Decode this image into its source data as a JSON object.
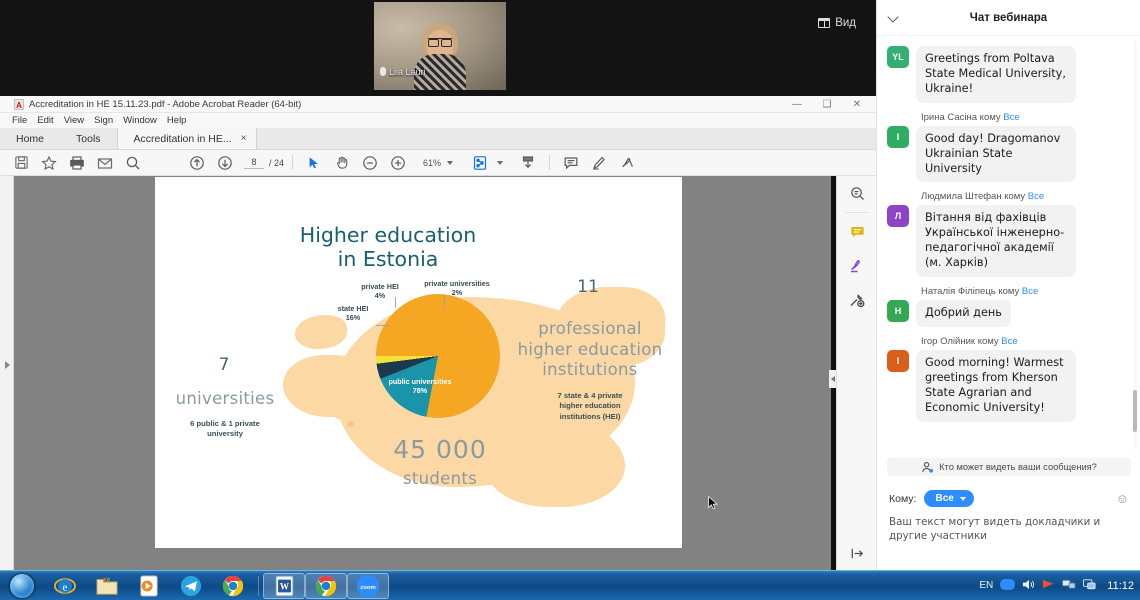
{
  "meeting": {
    "view_button_label": "Вид",
    "view_button_icon": "grid-view-icon",
    "speaker_name": "Liia Lauri"
  },
  "acrobat": {
    "window_title": "Accreditation in HE 15.11.23.pdf - Adobe Acrobat Reader (64-bit)",
    "menu": [
      "File",
      "Edit",
      "View",
      "Sign",
      "Window",
      "Help"
    ],
    "tabs": [
      {
        "label": "Home"
      },
      {
        "label": "Tools"
      },
      {
        "label": "Accreditation in HE...",
        "close": "×",
        "active": true
      }
    ],
    "window_controls": {
      "minimize": "—",
      "maximize": "❑",
      "close": "✕"
    },
    "toolbar": {
      "save_icon": "save-icon",
      "star_icon": "star-icon",
      "print_icon": "print-icon",
      "email_icon": "email-icon",
      "search_icon": "search-icon",
      "prev_page_icon": "arrow-up-circle-icon",
      "next_page_icon": "arrow-down-circle-icon",
      "current_page": "8",
      "page_total": "/ 24",
      "select_tool_icon": "cursor-arrow-icon",
      "hand_tool_icon": "hand-icon",
      "zoom_out_icon": "zoom-out-icon",
      "zoom_in_icon": "zoom-in-icon",
      "zoom_level": "61%",
      "page_fit_icon": "page-fit-icon",
      "scroll_mode_icon": "scroll-mode-icon",
      "comment_icon": "comment-icon",
      "highlight_icon": "highlight-pen-icon",
      "sign_icon": "sign-icon"
    },
    "right_tools": {
      "search_icon": "search-document-icon",
      "comment_icon": "comment-tool-icon",
      "fill_sign_icon": "fill-and-sign-icon",
      "more_tools_icon": "more-tools-icon",
      "expand_panel_icon": "expand-panel-icon",
      "collapse_arrow_icon": "collapse-left-arrow-icon"
    }
  },
  "slide": {
    "title_line1": "Higher education",
    "title_line2": "in Estonia",
    "universities_number": "7",
    "universities_word": "universities",
    "universities_note": "6 public & 1 private\nuniversity",
    "institutions_number": "11",
    "institutions_word": "professional\nhigher education\ninstitutions",
    "institutions_note": "7 state & 4 private\nhigher education\ninstitutions (HEI)",
    "students_number": "45 000",
    "students_word": "students",
    "colors": {
      "title": "#17616f",
      "map": "#fcd9a4",
      "public_universities": "#f5a623",
      "state_hei": "#1a94a8",
      "private_hei": "#1d3a4d",
      "private_universities": "#f5e33c"
    }
  },
  "chart_data": {
    "type": "pie",
    "title": "Higher education in Estonia",
    "categories": [
      "public universities",
      "state HEI",
      "private HEI",
      "private universities"
    ],
    "values": [
      78,
      16,
      4,
      2
    ],
    "value_labels": [
      "78%",
      "16%",
      "4%",
      "2%"
    ],
    "colors": [
      "#f5a623",
      "#1a94a8",
      "#1d3a4d",
      "#f5e33c"
    ],
    "unit": "percent",
    "legend": "inline-labels",
    "grid": false,
    "annotations": [
      "7 universities — 6 public & 1 private university",
      "11 professional higher education institutions — 7 state & 4 private higher education institutions (HEI)",
      "45 000 students"
    ]
  },
  "chat": {
    "title": "Чат вебинара",
    "collapse_icon": "chevron-down-icon",
    "messages": [
      {
        "from_line": null,
        "avatar_initials": "YL",
        "avatar_color": "#32b071",
        "text": "Greetings from Poltava State Medical University, Ukraine!"
      },
      {
        "from_name": "Ірина Сасіна кому ",
        "from_target": "Все",
        "avatar_initials": "I",
        "avatar_color": "#2fae63",
        "text": "Good day! Dragomanov Ukrainian State University"
      },
      {
        "from_name": "Людмила Штефан кому ",
        "from_target": "Все",
        "avatar_initials": "Л",
        "avatar_color": "#8e44c9",
        "text": "Вітання від фахівців Української інженерно-педагогічної академії (м. Харків)"
      },
      {
        "from_name": "Наталія Філіпець кому ",
        "from_target": "Все",
        "avatar_initials": "Н",
        "avatar_color": "#34a853",
        "text": "Добрий день"
      },
      {
        "from_name": "Ігор Олійник кому ",
        "from_target": "Все",
        "avatar_initials": "I",
        "avatar_color": "#d9601a",
        "text": "Good morning! Warmest greetings from Kherson State Agrarian and Economic University!"
      }
    ],
    "privacy_note": "Кто может видеть ваши сообщения?",
    "privacy_icon": "person-icon",
    "to_label": "Кому:",
    "to_value": "Все",
    "emoji_icon": "emoji-icon",
    "input_hint": "Ваш текст могут видеть докладчики и другие участники"
  },
  "taskbar": {
    "start_icon": "windows-start-orb",
    "pinned": [
      {
        "name": "internet-explorer-icon"
      },
      {
        "name": "folder-explorer-icon"
      },
      {
        "name": "media-player-icon"
      },
      {
        "name": "telegram-icon"
      },
      {
        "name": "chrome-icon"
      }
    ],
    "open_windows": [
      {
        "name": "word-icon"
      },
      {
        "name": "chrome-window-icon"
      },
      {
        "name": "zoom-icon",
        "label": "zoom"
      }
    ],
    "tray": {
      "language": "EN",
      "icons": [
        "zoom-tray-icon",
        "volume-icon",
        "flag-icon",
        "network-icon",
        "action-center-icon"
      ],
      "clock": "11:12"
    }
  }
}
